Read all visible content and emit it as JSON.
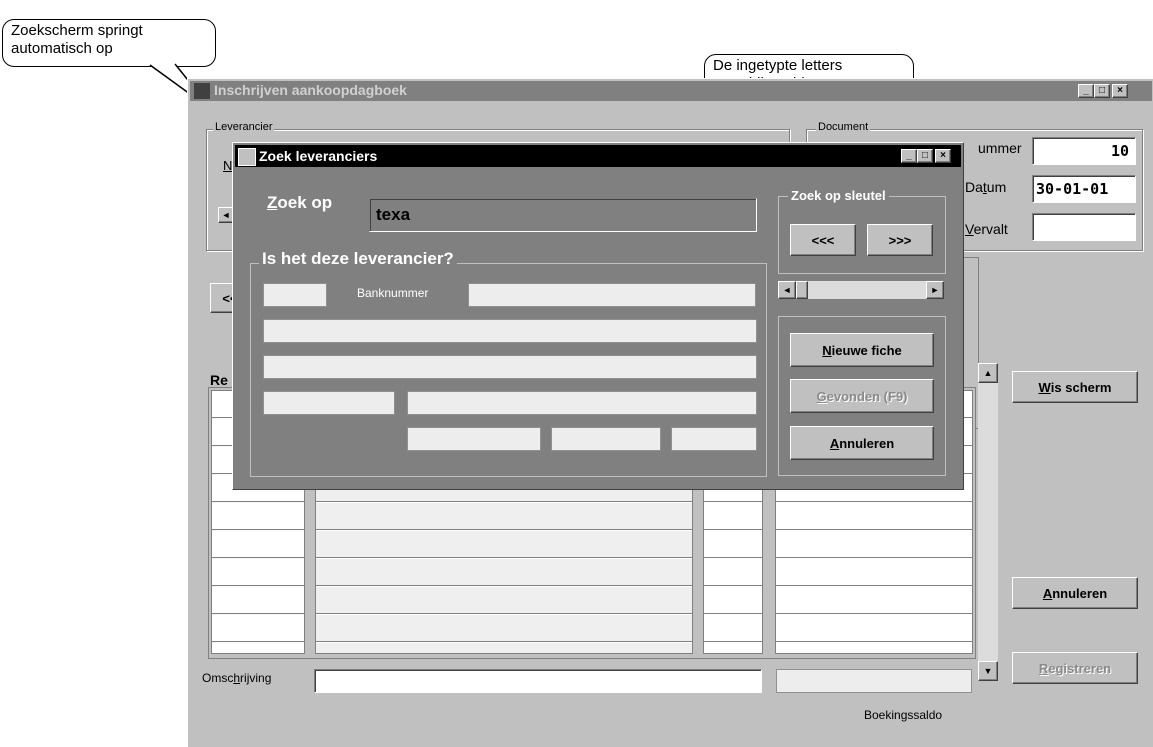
{
  "callouts": {
    "top_left": "Zoekscherm springt automatisch op",
    "top_right": "De ingetypte letters verschijnen hier"
  },
  "main_window": {
    "title": "Inschrijven aankoopdagboek",
    "controls": [
      "_",
      "□",
      "×"
    ],
    "leverancier_group_label": "Leverancier",
    "leverancier_first_letter": "N",
    "document_group_label": "Document",
    "nummer_label": "ummer",
    "nummer_value": "10",
    "datum_label": "Datum",
    "datum_value": "30-01-01",
    "vervalt_label": "Vervalt",
    "vervalt_value": "",
    "nav_prev": "<<",
    "left_arrow": "◄",
    "table_header_fragment": "Re",
    "wis_scherm_button": "Wis scherm",
    "annuleren_button": "Annuleren",
    "registreren_button": "Registreren",
    "omschrijving_label": "Omschrijving",
    "boekingssaldo_label": "Boekingssaldo"
  },
  "dialog": {
    "title": "Zoek leveranciers",
    "zoek_op_label": "Zoek op",
    "zoek_op_value": "texa",
    "zoek_op_sleutel_label": "Zoek op sleutel",
    "prev_button": "<<<",
    "next_button": ">>>",
    "is_het_label": "Is het deze leverancier?",
    "banknummer_label": "Banknummer",
    "nieuwe_fiche_button": "Nieuwe fiche",
    "gevonden_button": "Gevonden (F9)",
    "annuleren_button": "Annuleren"
  },
  "colors": {
    "title_active": "#000000",
    "title_inactive": "#808080",
    "dialog_bg": "#808080",
    "window_bg": "#c0c0c0"
  }
}
